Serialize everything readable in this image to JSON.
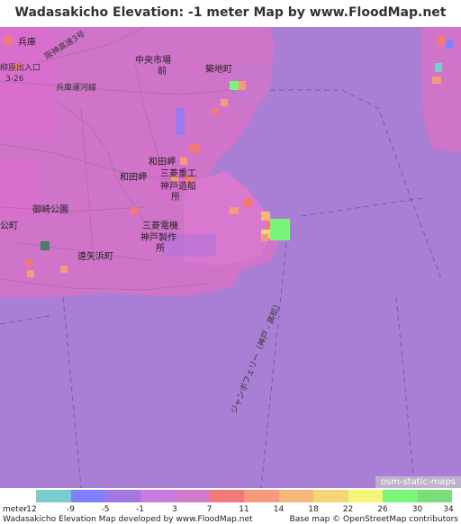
{
  "title": "Wadasakicho Elevation: -1 meter Map by www.FloodMap.net (beta)",
  "map_labels": {
    "hyogo": "兵庫",
    "tetsu_highway": "阪神高速3号",
    "chuo_market": "中央市場",
    "chuo_market_mae": "前",
    "tsukiji": "築地町",
    "exit": "柳原出入口",
    "route": "3-26",
    "hyogo_line": "兵庫運河線",
    "wadamisaki_station": "和田岬",
    "wadamisaki": "和田岬",
    "mitsubishi_heavy": "三菱重工",
    "kobe_shipyard": "神戸造船",
    "shipyard_suffix": "所",
    "mitsubishi_electric": "三菱電機",
    "kobe_works": "神戸製作",
    "works_suffix": "所",
    "misaki_park": "御崎公園",
    "toyahama": "遠矢浜町",
    "town_left": "公町",
    "ferry": "ジャンボフェリー（神戸 - 高松）",
    "osm_tag": "osm-static-maps"
  },
  "legend": {
    "unit_label": "meter",
    "ticks": [
      "-12",
      "-9",
      "-5",
      "-1",
      "3",
      "7",
      "11",
      "14",
      "18",
      "22",
      "26",
      "30",
      "34"
    ],
    "colors": [
      "#78cdcd",
      "#7f7fff",
      "#a577e0",
      "#c77be0",
      "#d47acd",
      "#f07a7a",
      "#f59a7a",
      "#f5b87a",
      "#f5d57a",
      "#f5f57a",
      "#7af57a",
      "#7adc7a"
    ]
  },
  "footer": {
    "left": "Wadasakicho Elevation Map developed by www.FloodMap.net",
    "right": "Base map © OpenStreetMap contributors"
  },
  "colors": {
    "sea": "#a87fd4",
    "land": "#cf74c8",
    "dense": "#e06ad0",
    "lowland": "#b675d8"
  }
}
